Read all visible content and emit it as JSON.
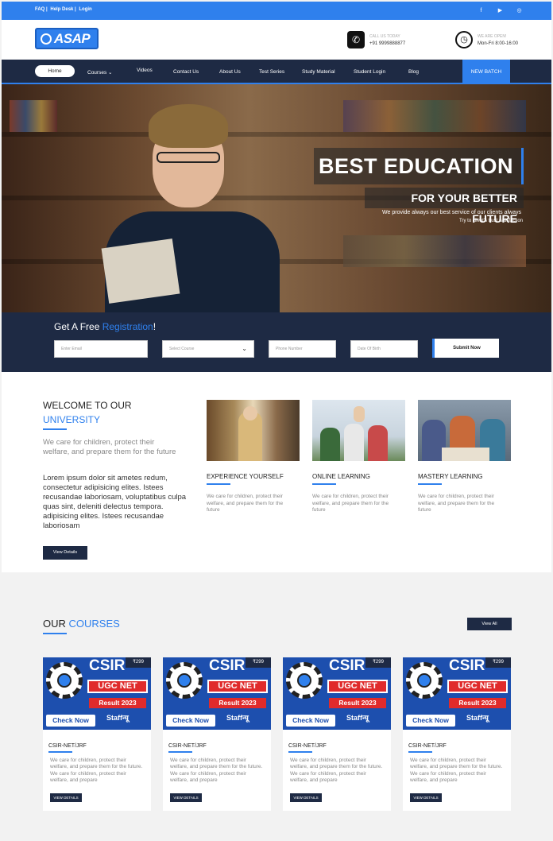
{
  "topbar": {
    "links": [
      "FAQ |",
      "Help Desk |",
      "Login"
    ],
    "social_icons": [
      "facebook-icon",
      "youtube-icon",
      "instagram-icon"
    ],
    "color": "#2f80ed"
  },
  "header": {
    "logo_text": "ASAP",
    "call_label": "CALL US TODAY",
    "call_value": "+91 9999888877",
    "open_label": "WE ARE OPEN!",
    "open_value": "Mon-Fri 8:00-16:00"
  },
  "nav": {
    "items": [
      "Home",
      "Courses",
      "Videos",
      "Contact Us",
      "About Us",
      "Test Series",
      "Study Material",
      "Student Login",
      "Blog"
    ],
    "cta": "NEW BATCH"
  },
  "hero": {
    "title": "BEST EDUCATION",
    "subtitle": "FOR YOUR BETTER FUTURE",
    "line1": "We provide always our best service of our clients always",
    "line2": "Try to client's trust satisfaction"
  },
  "registration": {
    "title_pre": "Get A Free ",
    "title_hl": "Registration",
    "title_post": "!",
    "email_placeholder": "Enter Email",
    "course_placeholder": "Select Course",
    "phone_placeholder": "Phone Number",
    "dob_placeholder": "Date Of Birth",
    "submit": "Submit Now"
  },
  "welcome": {
    "title": "WELCOME TO OUR",
    "title_hl": "UNIVERSITY",
    "sub": "We care for children, protect their welfare, and prepare them for the future",
    "lorem": "Lorem ipsum dolor sit ametes redum, consectetur adipisicing elites. Istees recusandae laboriosam, voluptatibus culpa quas sint, deleniti delectus tempora. adipisicing elites. Istees recusandae laboriosam",
    "button": "View Details",
    "cards": [
      {
        "title": "EXPERIENCE YOURSELF",
        "text": "We care for children, protect their welfare, and prepare them for the future"
      },
      {
        "title": "ONLINE LEARNING",
        "text": "We care for children, protect their welfare, and prepare them for the future"
      },
      {
        "title": "MASTERY LEARNING",
        "text": "We care for children, protect their welfare, and prepare them for the future"
      }
    ]
  },
  "courses": {
    "title": "OUR ",
    "title_hl": "COURSES",
    "view_all": "View All",
    "items": [
      {
        "name": "CSIR-NET/JRF",
        "price": "₹299",
        "desc": "We care for children, protect their welfare, and prepare them for the future. We care for children, protect  their welfare, and prepare",
        "button": "VIEW DETAILS"
      },
      {
        "name": "CSIR-NET/JRF",
        "price": "₹299",
        "desc": "We care for children, protect their welfare, and prepare them for the future. We care for children, protect  their welfare, and prepare",
        "button": "VIEW DETAILS"
      },
      {
        "name": "CSIR-NET/JRF",
        "price": "₹299",
        "desc": "We care for children, protect their welfare, and prepare them for the future. We care for children, protect  their welfare, and prepare",
        "button": "VIEW DETAILS"
      },
      {
        "name": "CSIR-NET/JRF",
        "price": "₹299",
        "desc": "We care for children, protect their welfare, and prepare them for the future. We care for children, protect  their welfare, and prepare",
        "button": "VIEW DETAILS"
      }
    ],
    "thumb": {
      "csir": "CSIR",
      "ugc": "UGC NET",
      "result": "Result 2023",
      "check": "Check Now",
      "staff": "Staffन्यू"
    }
  }
}
